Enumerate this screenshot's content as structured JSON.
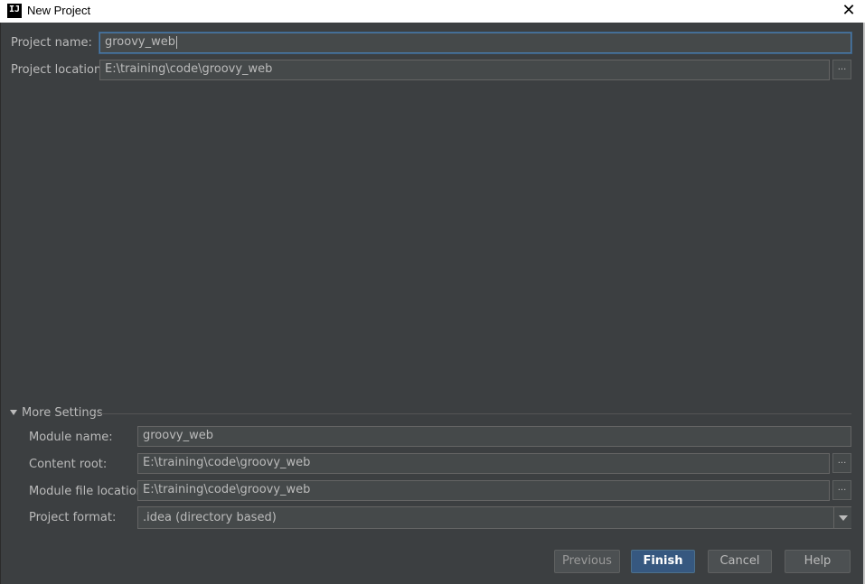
{
  "window": {
    "title": "New Project",
    "app_icon_text": "IJ",
    "close_glyph": "✕",
    "close_icon": "close-icon"
  },
  "project": {
    "name_label": "Project name:",
    "name_value": "groovy_web",
    "location_label": "Project location:",
    "location_value": "E:\\training\\code\\groovy_web",
    "browse_glyph": "..."
  },
  "more_settings": {
    "section_label": "More Settings",
    "expanded": true,
    "module_name_label": "Module name:",
    "module_name_value": "groovy_web",
    "content_root_label": "Content root:",
    "content_root_value": "E:\\training\\code\\groovy_web",
    "module_file_label": "Module file location:",
    "module_file_value": "E:\\training\\code\\groovy_web",
    "format_label": "Project format:",
    "format_value": ".idea (directory based)",
    "browse_glyph": "..."
  },
  "buttons": {
    "previous": "Previous",
    "finish": "Finish",
    "cancel": "Cancel",
    "help": "Help"
  },
  "colors": {
    "background": "#3c3f41",
    "field_bg": "#45494a",
    "focus_border": "#4b7aa8",
    "default_button": "#365880"
  }
}
